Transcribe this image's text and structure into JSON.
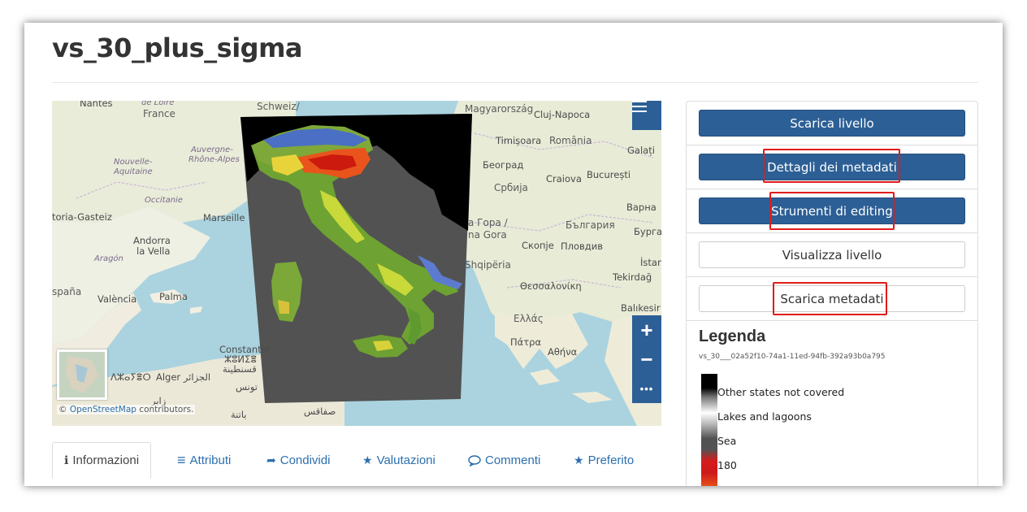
{
  "page": {
    "title": "vs_30_plus_sigma"
  },
  "map": {
    "labels": {
      "nantes": "Nantes",
      "de_loire": "de Loire",
      "france": "France",
      "schweiz": "Schweiz/",
      "magyarorszag": "Magyarország",
      "cluj": "Cluj-Napoca",
      "nouvelle": "Nouvelle-",
      "aquitaine": "Aquitaine",
      "auvergne": "Auvergne-",
      "rhone": "Rhône-Alpes",
      "timisoara": "Timișoara",
      "romania": "România",
      "galati": "Galați",
      "beograd": "Београд",
      "craiova": "Craiova",
      "bucuresti": "București",
      "occitanie": "Occitanie",
      "srbija": "Србија",
      "vitoria": "toria-Gasteiz",
      "marseille": "Marseille",
      "gora": "а Гора /",
      "gora2": "na Gora",
      "bulgaria": "България",
      "varna": "Варна",
      "andorra": "Andorra",
      "la_vella": "la Vella",
      "skopje": "Скопје",
      "plovdiv": "Пловдив",
      "burgas": "Бургас",
      "aragon": "Aragón",
      "shqiperia": "Shqipëria",
      "istan": "İstan",
      "espana": "spaña",
      "tekirdag": "Tekirdağ",
      "thessaloniki": "Θεσσαλονίκη",
      "valencia": "València",
      "palma": "Palma",
      "ellas": "Ελλάς",
      "balikesir": "Balıkesir",
      "patra": "Πάτρα",
      "athina": "Αθήνα",
      "constantine": "Constantin",
      "algerie": "ⵣⵓⵍⵉⴻ",
      "qusanta": "قسنطينة",
      "alger": "Alger الجزائر",
      "dzayer": "ⴷⵣⴰⵢⴻⵔ",
      "tunis": "تونس",
      "batna": "باتنة",
      "sfax": "صفاقس",
      "zayer": "زاير"
    },
    "controls": {
      "menu_icon": "menu-icon",
      "zoom_in": "+",
      "zoom_out": "−",
      "more": "•••"
    },
    "attribution": {
      "prefix": "© ",
      "link": "OpenStreetMap",
      "suffix": " contributors."
    }
  },
  "tabs": [
    {
      "icon": "info-circle-icon",
      "glyph": "ℹ",
      "label": "Informazioni",
      "active": true
    },
    {
      "icon": "list-icon",
      "glyph": "≡",
      "label": "Attributi"
    },
    {
      "icon": "share-icon",
      "glyph": "➦",
      "label": "Condividi"
    },
    {
      "icon": "star-icon",
      "glyph": "★",
      "label": "Valutazioni"
    },
    {
      "icon": "comment-icon",
      "glyph": "💬",
      "label": "Commenti"
    },
    {
      "icon": "star-icon",
      "glyph": "★",
      "label": "Preferito"
    }
  ],
  "panel": {
    "buttons": [
      {
        "label": "Scarica livello",
        "style": "primary"
      },
      {
        "label": "Dettagli dei metadati",
        "style": "primary",
        "highlighted": true
      },
      {
        "label": "Strumenti di editing",
        "style": "primary",
        "highlighted": true
      },
      {
        "label": "Visualizza livello",
        "style": "default"
      },
      {
        "label": "Scarica metadati",
        "style": "default",
        "highlighted": true
      }
    ],
    "legend": {
      "title": "Legenda",
      "layer_id": "vs_30___02a52f10-74a1-11ed-94fb-392a93b0a795",
      "items": [
        "Other states not covered",
        "Lakes and lagoons",
        "Sea",
        "180"
      ]
    }
  },
  "colors": {
    "primary": "#2c5f95",
    "highlight": "#e01b1b",
    "link": "#2c6fad"
  }
}
